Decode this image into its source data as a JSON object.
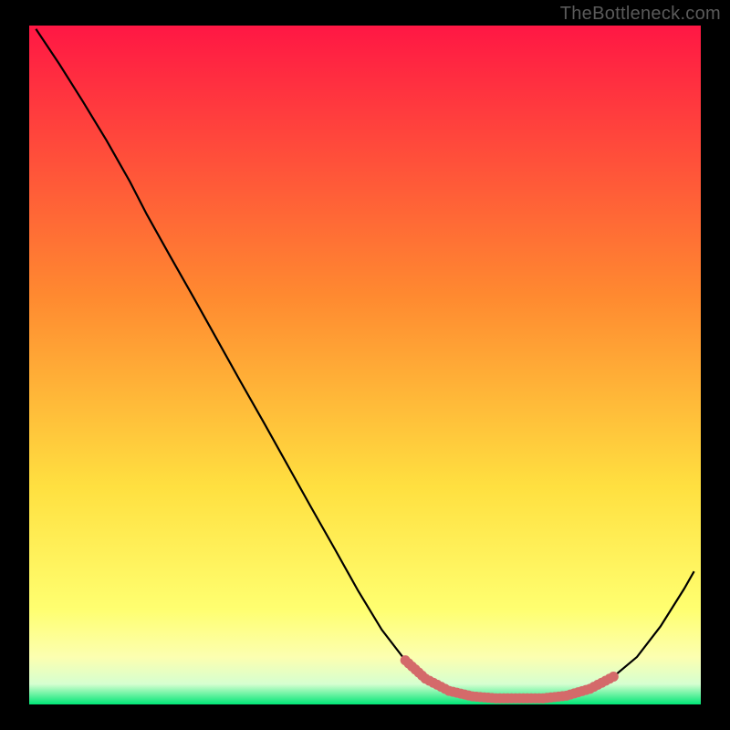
{
  "watermark": "TheBottleneck.com",
  "chart_data": {
    "type": "line",
    "title": "",
    "xlabel": "",
    "ylabel": "",
    "xlim": [
      0,
      100
    ],
    "ylim": [
      0,
      100
    ],
    "grid": false,
    "gradient_stops": [
      {
        "offset": 0,
        "color": "#ff1744"
      },
      {
        "offset": 40,
        "color": "#ff8a30"
      },
      {
        "offset": 68,
        "color": "#ffe040"
      },
      {
        "offset": 86,
        "color": "#ffff70"
      },
      {
        "offset": 93,
        "color": "#fcffb0"
      },
      {
        "offset": 97,
        "color": "#d6ffd0"
      },
      {
        "offset": 100,
        "color": "#00e676"
      }
    ],
    "series": [
      {
        "name": "bottleneck-curve",
        "color": "#000000",
        "points": [
          {
            "x": 1.0,
            "y": 99.5
          },
          {
            "x": 4.5,
            "y": 94.3
          },
          {
            "x": 8.0,
            "y": 88.8
          },
          {
            "x": 11.5,
            "y": 83.1
          },
          {
            "x": 15.0,
            "y": 77.0
          },
          {
            "x": 17.5,
            "y": 72.2
          },
          {
            "x": 21.0,
            "y": 66.0
          },
          {
            "x": 24.5,
            "y": 59.9
          },
          {
            "x": 28.0,
            "y": 53.7
          },
          {
            "x": 31.5,
            "y": 47.5
          },
          {
            "x": 35.0,
            "y": 41.4
          },
          {
            "x": 38.5,
            "y": 35.2
          },
          {
            "x": 42.0,
            "y": 29.0
          },
          {
            "x": 45.5,
            "y": 22.9
          },
          {
            "x": 49.0,
            "y": 16.7
          },
          {
            "x": 52.5,
            "y": 11.0
          },
          {
            "x": 56.0,
            "y": 6.5
          },
          {
            "x": 59.0,
            "y": 3.8
          },
          {
            "x": 62.5,
            "y": 2.0
          },
          {
            "x": 66.0,
            "y": 1.2
          },
          {
            "x": 69.5,
            "y": 0.9
          },
          {
            "x": 73.0,
            "y": 0.9
          },
          {
            "x": 76.5,
            "y": 0.9
          },
          {
            "x": 80.0,
            "y": 1.3
          },
          {
            "x": 83.5,
            "y": 2.3
          },
          {
            "x": 87.0,
            "y": 4.1
          },
          {
            "x": 90.5,
            "y": 7.0
          },
          {
            "x": 94.0,
            "y": 11.5
          },
          {
            "x": 97.5,
            "y": 17.0
          },
          {
            "x": 99.0,
            "y": 19.6
          }
        ]
      },
      {
        "name": "optimal-zone",
        "color": "#d46a6a",
        "style": "dotted-thick",
        "points": [
          {
            "x": 56.0,
            "y": 6.5
          },
          {
            "x": 59.0,
            "y": 3.8
          },
          {
            "x": 62.5,
            "y": 2.0
          },
          {
            "x": 66.0,
            "y": 1.2
          },
          {
            "x": 69.5,
            "y": 0.9
          },
          {
            "x": 73.0,
            "y": 0.9
          },
          {
            "x": 76.5,
            "y": 0.9
          },
          {
            "x": 80.0,
            "y": 1.3
          },
          {
            "x": 83.5,
            "y": 2.3
          },
          {
            "x": 87.0,
            "y": 4.1
          }
        ]
      }
    ]
  }
}
